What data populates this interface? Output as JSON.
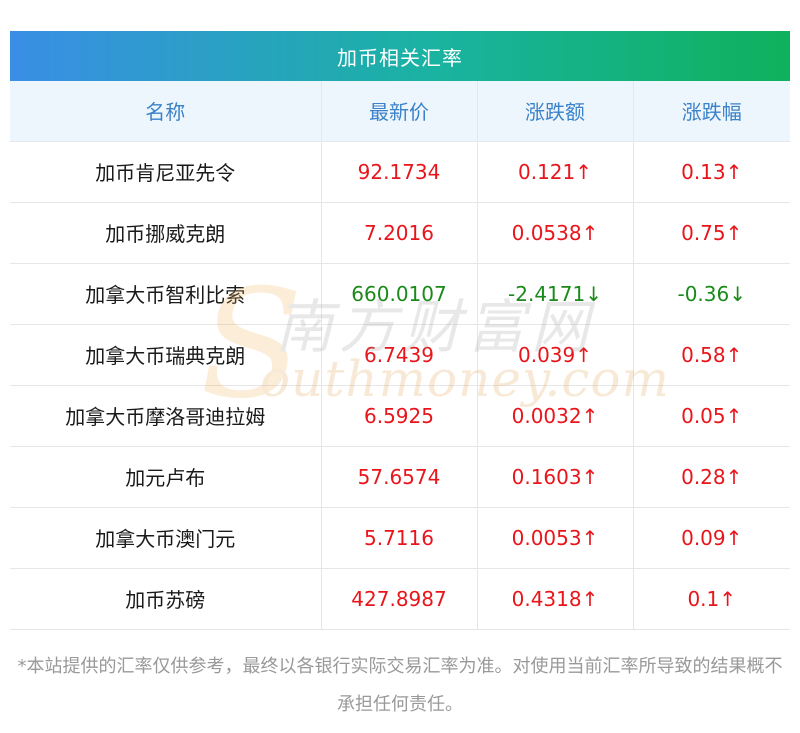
{
  "title": "加币相关汇率",
  "headers": [
    "名称",
    "最新价",
    "涨跌额",
    "涨跌幅"
  ],
  "rows": [
    {
      "name": "加币肯尼亚先令",
      "price": "92.1734",
      "change": "0.121↑",
      "pct": "0.13↑",
      "dir": "up"
    },
    {
      "name": "加币挪威克朗",
      "price": "7.2016",
      "change": "0.0538↑",
      "pct": "0.75↑",
      "dir": "up"
    },
    {
      "name": "加拿大币智利比索",
      "price": "660.0107",
      "change": "-2.4171↓",
      "pct": "-0.36↓",
      "dir": "down"
    },
    {
      "name": "加拿大币瑞典克朗",
      "price": "6.7439",
      "change": "0.039↑",
      "pct": "0.58↑",
      "dir": "up"
    },
    {
      "name": "加拿大币摩洛哥迪拉姆",
      "price": "6.5925",
      "change": "0.0032↑",
      "pct": "0.05↑",
      "dir": "up"
    },
    {
      "name": "加元卢布",
      "price": "57.6574",
      "change": "0.1603↑",
      "pct": "0.28↑",
      "dir": "up"
    },
    {
      "name": "加拿大币澳门元",
      "price": "5.7116",
      "change": "0.0053↑",
      "pct": "0.09↑",
      "dir": "up"
    },
    {
      "name": "加币苏磅",
      "price": "427.8987",
      "change": "0.4318↑",
      "pct": "0.1↑",
      "dir": "up"
    }
  ],
  "watermark": {
    "logo_cn": "南方财富网",
    "logo_en": "southmoney.com"
  },
  "disclaimer": "*本站提供的汇率仅供参考，最终以各银行实际交易汇率为准。对使用当前汇率所导致的结果概不承担任何责任。",
  "colors": {
    "up": "#e8151b",
    "down": "#1a8a1a",
    "header_text": "#3b82c9",
    "title_gradient_start": "#3a8ee6",
    "title_gradient_end": "#0fb15c"
  }
}
